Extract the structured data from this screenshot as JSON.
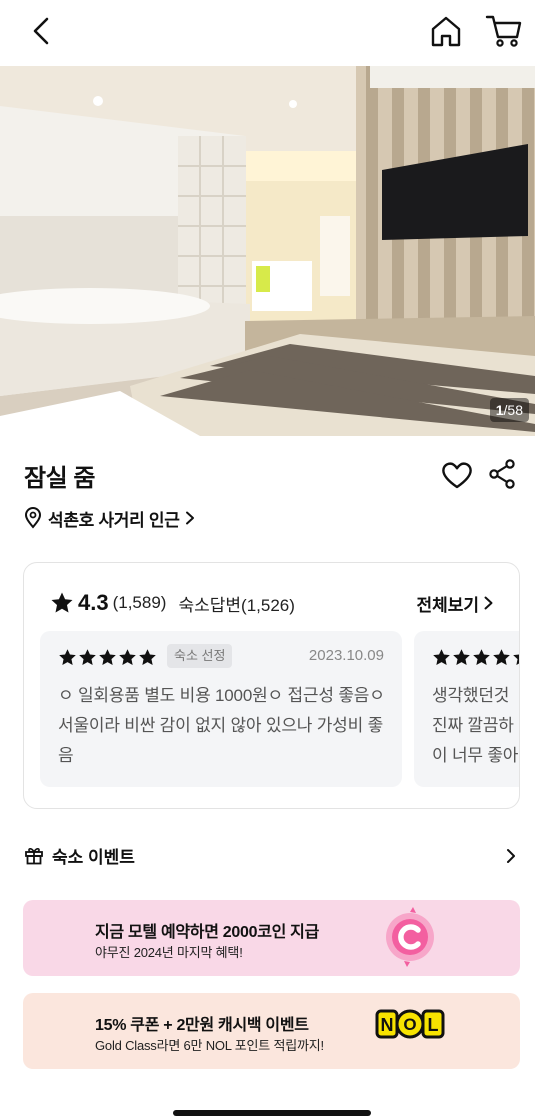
{
  "nav": {
    "back_icon": "chevron-left-icon",
    "home_icon": "home-icon",
    "cart_icon": "cart-icon"
  },
  "gallery": {
    "current": "1",
    "total": "/58"
  },
  "property": {
    "name": "잠실 줌",
    "location": "석촌호 사거리 인근"
  },
  "reviews": {
    "score": "4.3",
    "count": "(1,589)",
    "answers": "숙소답변(1,526)",
    "see_all": "전체보기",
    "items": [
      {
        "stars": 5,
        "badge": "숙소 선정",
        "date": "2023.10.09",
        "text": "ㅇ 일회용품 별도 비용 1000원ㅇ 접근성 좋음ㅇ 서울이라 비싼 감이 없지 않아 있으나 가성비 좋음"
      },
      {
        "stars": 5,
        "line1": "생각했던것",
        "line2": "진짜 깔끔하",
        "line3": "이 너무 좋아"
      }
    ]
  },
  "events": {
    "title": "숙소 이벤트",
    "banners": [
      {
        "main": "지금 모텔 예약하면 2000코인 지급",
        "sub": "야무진 2024년 마지막 혜택!",
        "color": "#f9d8e7",
        "icon": "coin-c-icon"
      },
      {
        "main": "15% 쿠폰 + 2만원 캐시백 이벤트",
        "sub": "Gold Class라면 6만 NOL 포인트 적립까지!",
        "color": "#fbe6dd",
        "icon": "nol-logo-icon",
        "logo_text": "NOL"
      }
    ]
  },
  "colors": {
    "accent_pink": "#f35fa0",
    "nol_yellow": "#f7e200",
    "text_primary": "#111111",
    "text_muted": "#888888"
  }
}
